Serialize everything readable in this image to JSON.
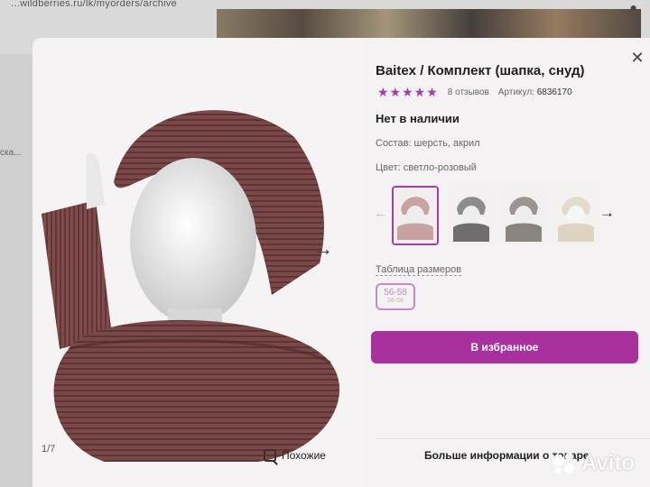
{
  "background": {
    "url_text": "...wildberries.ru/lk/myorders/archive",
    "side_text": "ска..."
  },
  "modal": {
    "title": "Baitex / Комплект (шапка, снуд)",
    "rating": {
      "stars": 5,
      "reviews": "8 отзывов",
      "article_label": "Артикул:",
      "article_value": "6836170"
    },
    "stock": "Нет в наличии",
    "composition": "Состав: шерсть, акрил",
    "color": "Цвет: светло-розовый",
    "swatches": [
      {
        "name": "светло-розовый",
        "selected": true,
        "hue": "#c9a2a2"
      },
      {
        "name": "серый",
        "selected": false,
        "hue": "#8d8b8b"
      },
      {
        "name": "серо-бежевый",
        "selected": false,
        "hue": "#9c958f"
      },
      {
        "name": "молочный",
        "selected": false,
        "hue": "#e3dccd"
      }
    ],
    "size_table_link": "Таблица размеров",
    "size": {
      "main": "56-58",
      "sub": "56-58"
    },
    "favorite_button": "В избранное",
    "more_info": "Больше информации о товаре",
    "image_counter": "1/7",
    "similar_button": "Похожие",
    "accent_color": "#a9309f"
  },
  "watermark": "Avito"
}
